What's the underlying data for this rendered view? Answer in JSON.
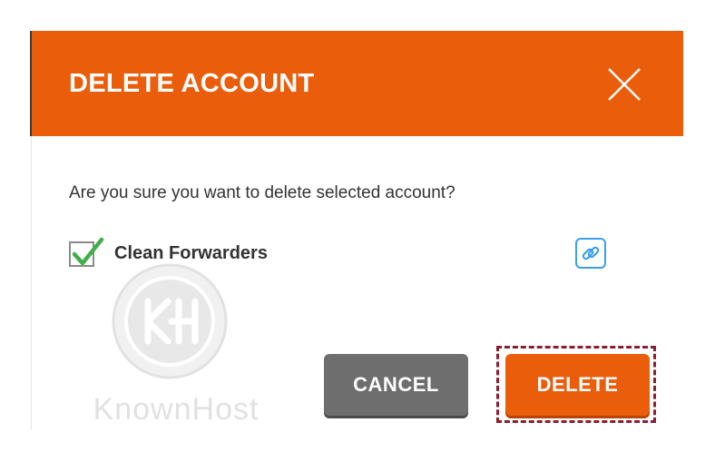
{
  "dialog": {
    "title": "DELETE ACCOUNT",
    "question": "Are you sure you want to delete selected account?",
    "option": {
      "label": "Clean Forwarders",
      "checked": true
    },
    "buttons": {
      "cancel": "CANCEL",
      "delete": "DELETE"
    },
    "icons": {
      "close": "close-icon",
      "check": "checkmark-icon",
      "link": "link-icon"
    }
  },
  "watermark": {
    "letter": "KH",
    "text": "KnownHost"
  },
  "colors": {
    "accent": "#ea5d0b",
    "cancel_bg": "#6e6e6e",
    "check": "#3fae49",
    "link_border": "#3aa0ec",
    "highlight": "#8e1d32"
  }
}
